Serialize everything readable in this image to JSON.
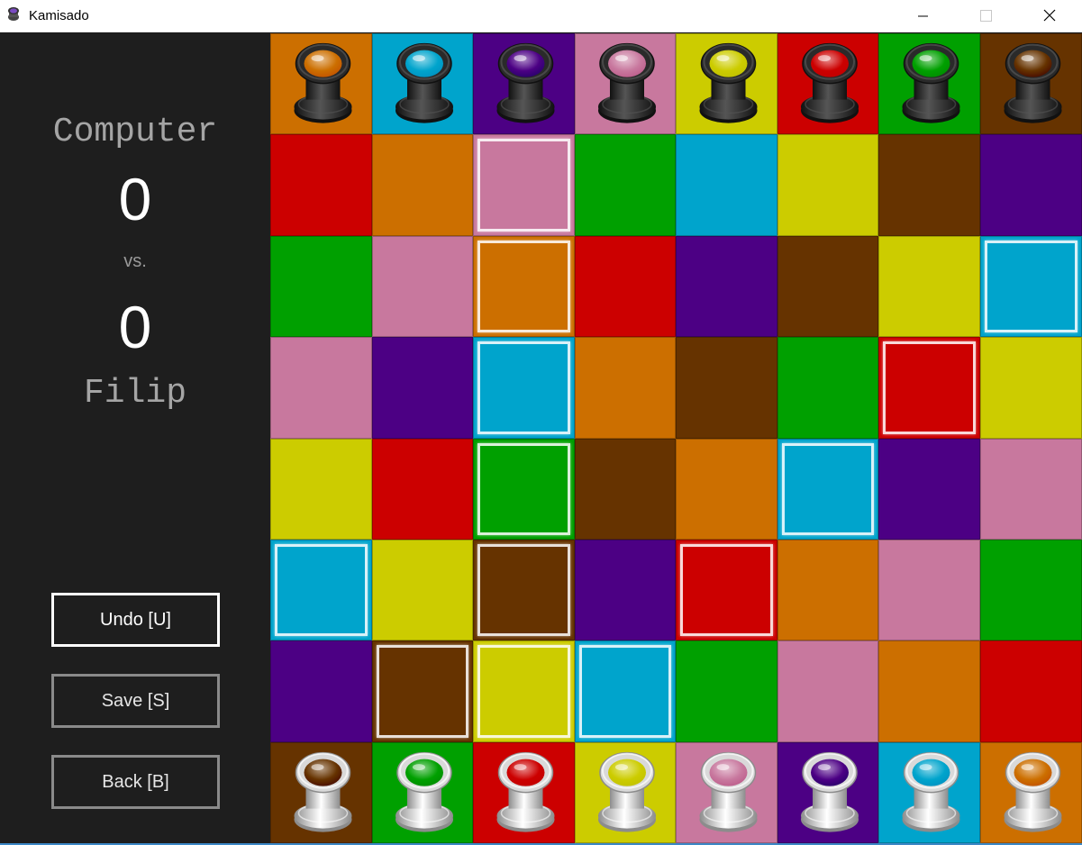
{
  "window": {
    "title": "Kamisado",
    "icon": "kamisado-app-icon",
    "controls": [
      "minimize-icon",
      "maximize-icon",
      "close-icon"
    ]
  },
  "panel": {
    "top_player": "Computer",
    "top_score": "0",
    "vs_label": "vs.",
    "bottom_score": "0",
    "bottom_player": "Filip",
    "buttons": {
      "undo": "Undo [U]",
      "save": "Save [S]",
      "back": "Back [B]"
    }
  },
  "colors": {
    "orange": "#cc6f00",
    "blue": "#00a4cc",
    "purple": "#4c0084",
    "pink": "#c8789e",
    "yellow": "#cccc00",
    "red": "#cc0000",
    "green": "#00a000",
    "brown": "#663300"
  },
  "board": {
    "rows": [
      [
        "orange",
        "blue",
        "purple",
        "pink",
        "yellow",
        "red",
        "green",
        "brown"
      ],
      [
        "red",
        "orange",
        "pink",
        "green",
        "blue",
        "yellow",
        "brown",
        "purple"
      ],
      [
        "green",
        "pink",
        "orange",
        "red",
        "purple",
        "brown",
        "yellow",
        "blue"
      ],
      [
        "pink",
        "purple",
        "blue",
        "orange",
        "brown",
        "green",
        "red",
        "yellow"
      ],
      [
        "yellow",
        "red",
        "green",
        "brown",
        "orange",
        "blue",
        "purple",
        "pink"
      ],
      [
        "blue",
        "yellow",
        "brown",
        "purple",
        "red",
        "orange",
        "pink",
        "green"
      ],
      [
        "purple",
        "brown",
        "yellow",
        "blue",
        "green",
        "pink",
        "orange",
        "red"
      ],
      [
        "brown",
        "green",
        "red",
        "yellow",
        "pink",
        "purple",
        "blue",
        "orange"
      ]
    ],
    "highlighted": [
      [
        1,
        2
      ],
      [
        2,
        2
      ],
      [
        2,
        7
      ],
      [
        3,
        2
      ],
      [
        3,
        6
      ],
      [
        4,
        2
      ],
      [
        4,
        5
      ],
      [
        5,
        0
      ],
      [
        5,
        2
      ],
      [
        5,
        4
      ],
      [
        6,
        1
      ],
      [
        6,
        2
      ],
      [
        6,
        3
      ]
    ],
    "pieces": [
      {
        "row": 0,
        "col": 0,
        "player": "black",
        "color": "orange"
      },
      {
        "row": 0,
        "col": 1,
        "player": "black",
        "color": "blue"
      },
      {
        "row": 0,
        "col": 2,
        "player": "black",
        "color": "purple"
      },
      {
        "row": 0,
        "col": 3,
        "player": "black",
        "color": "pink"
      },
      {
        "row": 0,
        "col": 4,
        "player": "black",
        "color": "yellow"
      },
      {
        "row": 0,
        "col": 5,
        "player": "black",
        "color": "red"
      },
      {
        "row": 0,
        "col": 6,
        "player": "black",
        "color": "green"
      },
      {
        "row": 0,
        "col": 7,
        "player": "black",
        "color": "brown"
      },
      {
        "row": 7,
        "col": 0,
        "player": "white",
        "color": "brown"
      },
      {
        "row": 7,
        "col": 1,
        "player": "white",
        "color": "green"
      },
      {
        "row": 7,
        "col": 2,
        "player": "white",
        "color": "red"
      },
      {
        "row": 7,
        "col": 3,
        "player": "white",
        "color": "yellow"
      },
      {
        "row": 7,
        "col": 4,
        "player": "white",
        "color": "pink"
      },
      {
        "row": 7,
        "col": 5,
        "player": "white",
        "color": "purple"
      },
      {
        "row": 7,
        "col": 6,
        "player": "white",
        "color": "blue"
      },
      {
        "row": 7,
        "col": 7,
        "player": "white",
        "color": "orange"
      }
    ],
    "piece_icon": "tower-piece-icon"
  }
}
